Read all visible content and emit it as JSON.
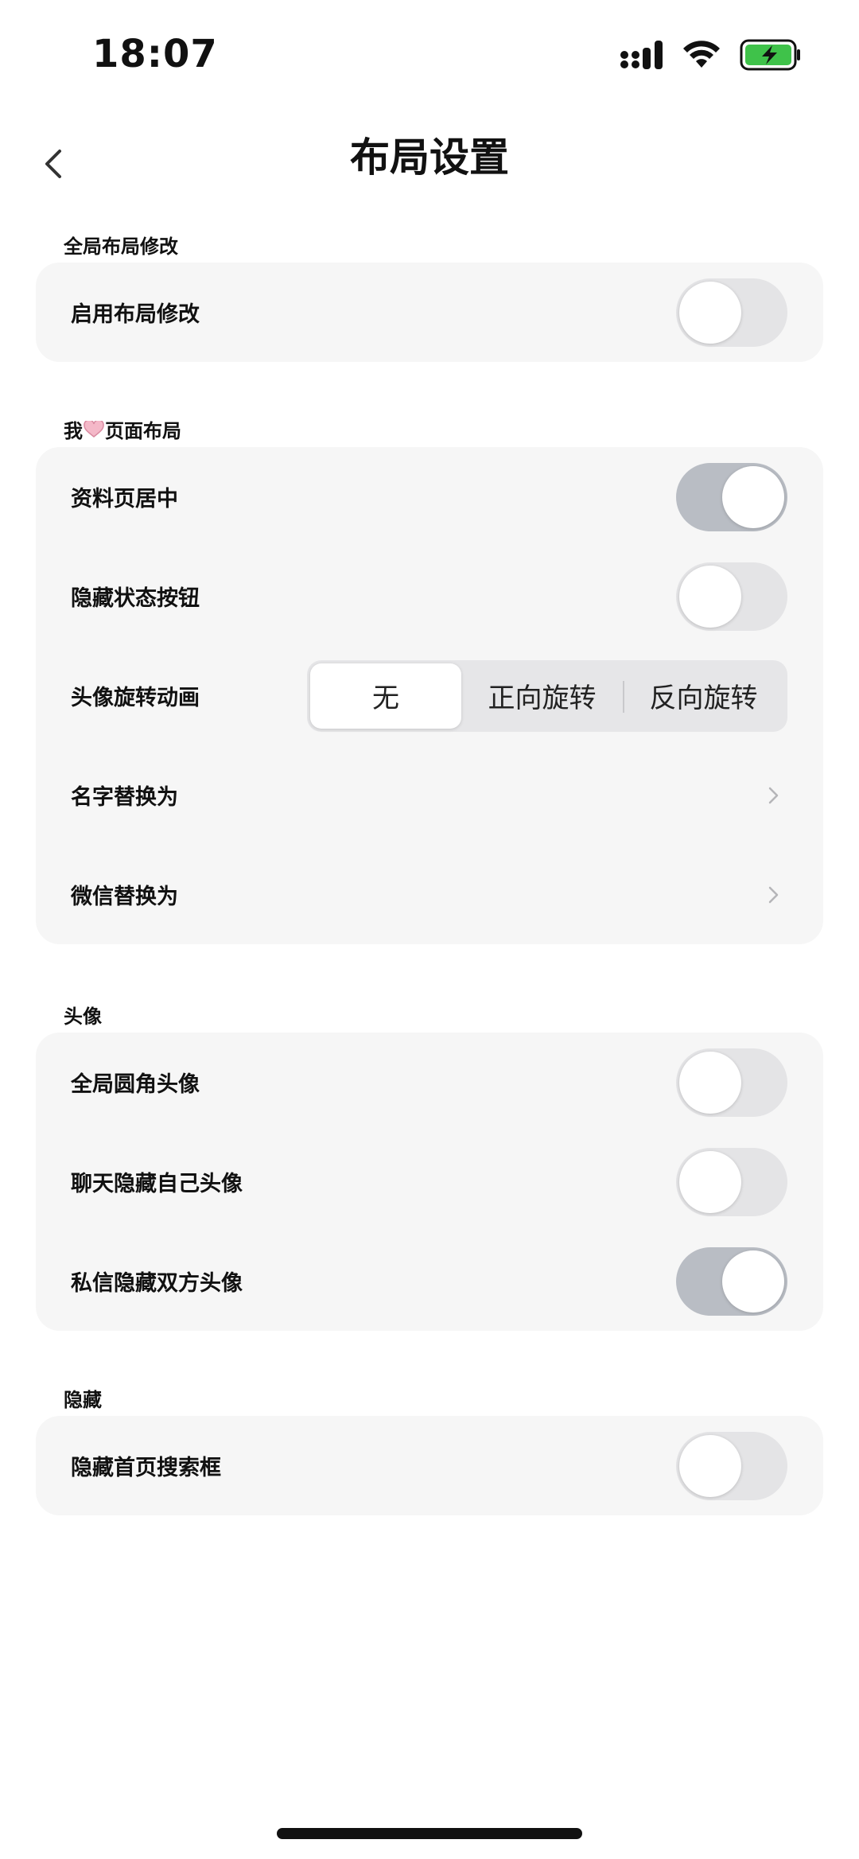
{
  "status_bar": {
    "time": "18:07",
    "icons": [
      "cellular-signal-icon",
      "wifi-icon",
      "battery-charging-icon"
    ],
    "battery_color": "#3fc24a"
  },
  "nav": {
    "title": "布局设置",
    "back_icon": "chevron-left-icon"
  },
  "sections": {
    "global": {
      "header": "全局布局修改",
      "rows": [
        {
          "label": "启用布局修改",
          "toggle": false
        }
      ]
    },
    "profile": {
      "header_prefix": "我",
      "header_suffix": "页面布局",
      "rows": [
        {
          "label": "资料页居中",
          "toggle": true
        },
        {
          "label": "隐藏状态按钮",
          "toggle": false
        },
        {
          "label": "头像旋转动画",
          "segments": [
            "无",
            "正向旋转",
            "反向旋转"
          ],
          "selected": "无"
        },
        {
          "label": "名字替换为"
        },
        {
          "label": "微信替换为"
        }
      ]
    },
    "avatar": {
      "header": "头像",
      "rows": [
        {
          "label": "全局圆角头像",
          "toggle": false
        },
        {
          "label": "聊天隐藏自己头像",
          "toggle": false
        },
        {
          "label": "私信隐藏双方头像",
          "toggle": true
        }
      ]
    },
    "hide": {
      "header": "隐藏",
      "rows": [
        {
          "label": "隐藏首页搜索框",
          "toggle": false
        }
      ]
    }
  },
  "colors": {
    "card_bg": "#f6f6f6",
    "toggle_off": "#e4e4e6",
    "toggle_on": "#b9bdc4",
    "heart_accent": "#f4b8c8"
  }
}
